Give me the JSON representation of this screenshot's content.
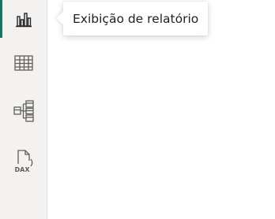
{
  "nav": {
    "items": [
      {
        "id": "report",
        "icon": "bar-chart-icon",
        "active": true
      },
      {
        "id": "table",
        "icon": "table-grid-icon",
        "active": false
      },
      {
        "id": "model",
        "icon": "model-diagram-icon",
        "active": false
      },
      {
        "id": "dax",
        "icon": "dax-query-icon",
        "active": false,
        "icon_text": "DAX"
      }
    ],
    "accent_color": "#117865"
  },
  "tooltip": {
    "text": "Exibição de relatório"
  }
}
